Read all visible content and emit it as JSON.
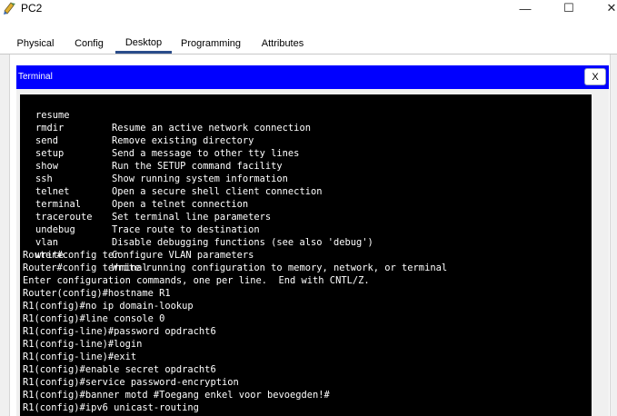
{
  "window": {
    "title": "PC2",
    "minimize_glyph": "—",
    "maximize_glyph": "☐",
    "close_glyph": "✕"
  },
  "tabs": [
    {
      "label": "Physical"
    },
    {
      "label": "Config"
    },
    {
      "label": "Desktop"
    },
    {
      "label": "Programming"
    },
    {
      "label": "Attributes"
    }
  ],
  "active_tab": "Desktop",
  "terminal": {
    "title": "Terminal",
    "close_label": "X",
    "command_help": [
      {
        "cmd": "resume",
        "desc": "Resume an active network connection"
      },
      {
        "cmd": "rmdir",
        "desc": "Remove existing directory"
      },
      {
        "cmd": "send",
        "desc": "Send a message to other tty lines"
      },
      {
        "cmd": "setup",
        "desc": "Run the SETUP command facility"
      },
      {
        "cmd": "show",
        "desc": "Show running system information"
      },
      {
        "cmd": "ssh",
        "desc": "Open a secure shell client connection"
      },
      {
        "cmd": "telnet",
        "desc": "Open a telnet connection"
      },
      {
        "cmd": "terminal",
        "desc": "Set terminal line parameters"
      },
      {
        "cmd": "traceroute",
        "desc": "Trace route to destination"
      },
      {
        "cmd": "undebug",
        "desc": "Disable debugging functions (see also 'debug')"
      },
      {
        "cmd": "vlan",
        "desc": "Configure VLAN parameters"
      },
      {
        "cmd": "write",
        "desc": "Write running configuration to memory, network, or terminal"
      }
    ],
    "lines": [
      "Router#config ter",
      "Router#config terminal",
      "Enter configuration commands, one per line.  End with CNTL/Z.",
      "Router(config)#hostname R1",
      "R1(config)#no ip domain-lookup",
      "R1(config)#line console 0",
      "R1(config-line)#password opdracht6",
      "R1(config-line)#login",
      "R1(config-line)#exit",
      "R1(config)#enable secret opdracht6",
      "R1(config)#service password-encryption",
      "R1(config)#banner motd #Toegang enkel voor bevoegden!#",
      "R1(config)#ipv6 unicast-routing"
    ]
  },
  "colors": {
    "terminal_header": "#0000ff",
    "terminal_background": "#000000",
    "terminal_text": "#ffffff",
    "active_tab_underline": "#2a4c8a"
  },
  "icons": {
    "app": "packet-tracer-pc-icon",
    "close": "close-icon"
  }
}
